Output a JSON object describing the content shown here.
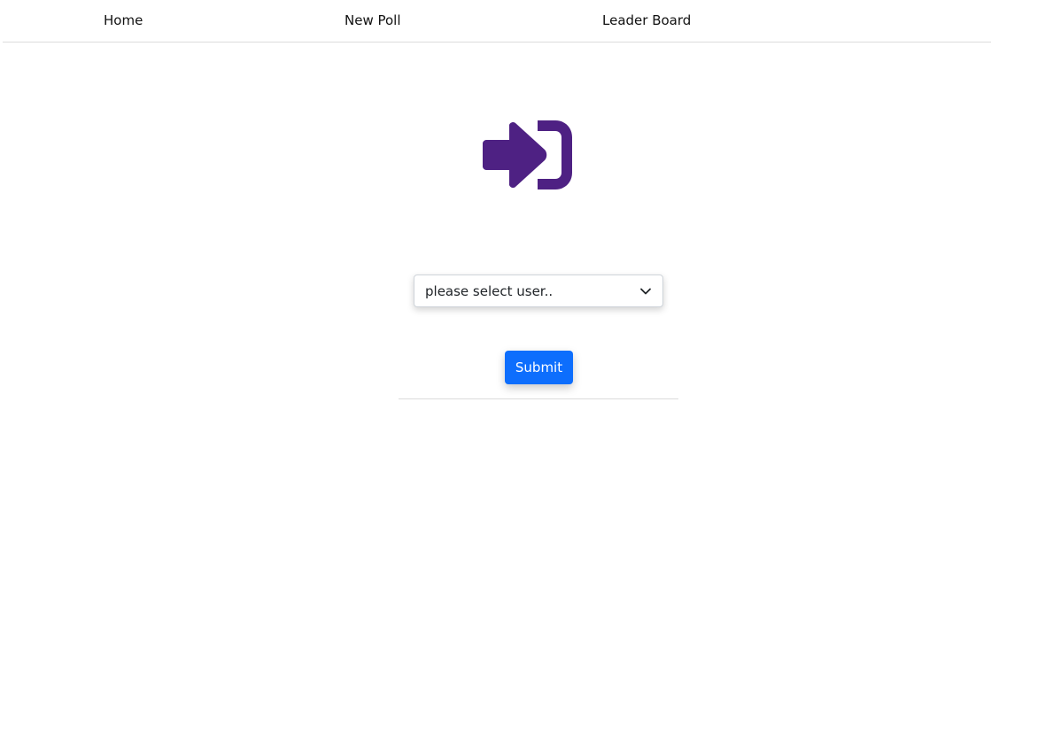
{
  "nav": {
    "links": [
      {
        "label": "Home"
      },
      {
        "label": "New Poll"
      },
      {
        "label": "Leader Board"
      }
    ]
  },
  "login": {
    "icon": "sign-in-icon",
    "icon_color": "#4e2183",
    "user_select": {
      "selected_value": "please select user.."
    },
    "submit_label": "Submit",
    "submit_color": "#0d6efd"
  }
}
